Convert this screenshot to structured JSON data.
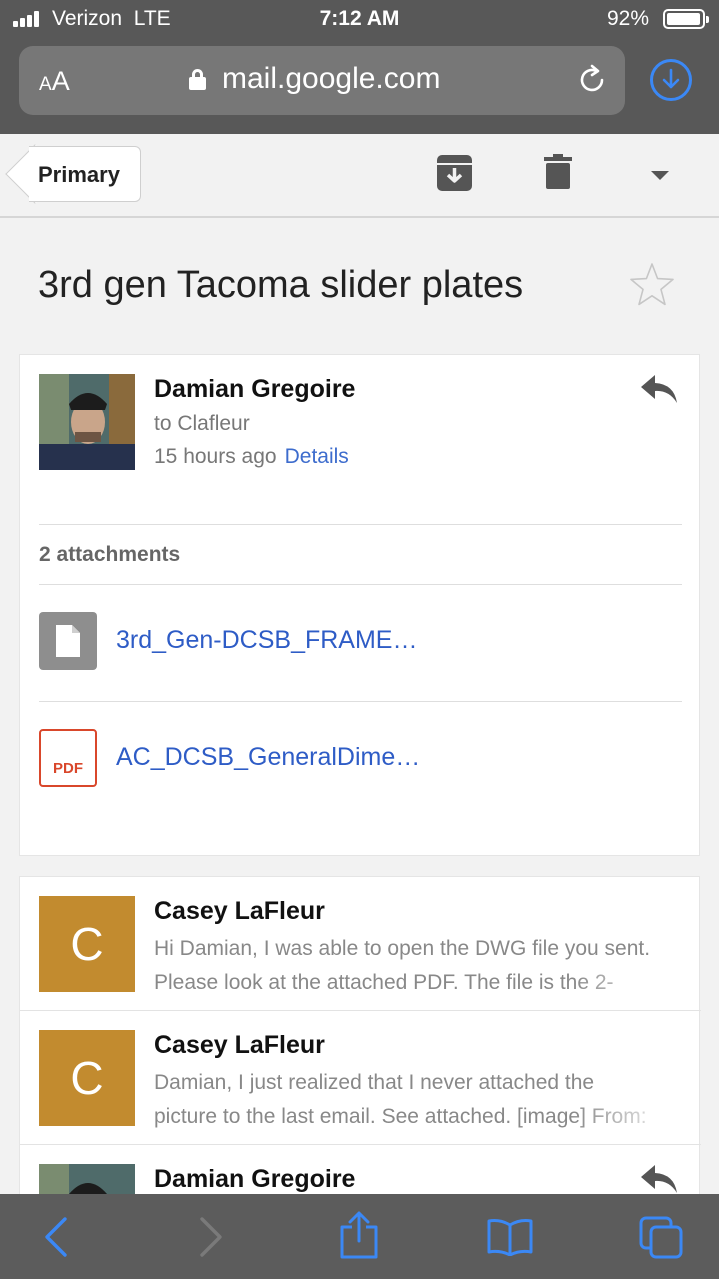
{
  "status": {
    "carrier": "Verizon",
    "network": "LTE",
    "time": "7:12 AM",
    "battery": "92%",
    "battery_level": 0.92
  },
  "browser": {
    "text_size_label_small": "A",
    "text_size_label_large": "A",
    "url": "mail.google.com",
    "icons": [
      "lock-icon",
      "reload-icon",
      "download-icon"
    ]
  },
  "toolbar": {
    "back_label": "Primary",
    "icons": [
      "archive-icon",
      "trash-icon",
      "more-dropdown-icon"
    ]
  },
  "email": {
    "subject": "3rd gen Tacoma slider plates",
    "starred": false,
    "sender": "Damian Gregoire",
    "recipient": "to Clafleur",
    "time": "15 hours ago",
    "details_label": "Details",
    "attachments_label": "2 attachments",
    "attachments": [
      {
        "name": "3rd_Gen-DCSB_FRAME…",
        "type": "file"
      },
      {
        "name": "AC_DCSB_GeneralDime…",
        "type": "pdf",
        "badge": "PDF"
      }
    ]
  },
  "thread": [
    {
      "avatar_letter": "C",
      "name": "Casey LaFleur",
      "line1": "Hi Damian, I was able to open the DWG file you sent.",
      "line2": "Please look at the attached PDF. The file is the 2-"
    },
    {
      "avatar_letter": "C",
      "name": "Casey LaFleur",
      "line1": "Damian, I just realized that I never attached the",
      "line2": "picture to the last email. See attached. [image] From:"
    },
    {
      "avatar_letter": "",
      "name": "Damian Gregoire",
      "line1": "",
      "line2": ""
    }
  ],
  "colors": {
    "avatar_letter_bg": "#c28b2f",
    "link": "#2e5cc6",
    "safari_bar": "#585858",
    "ios_blue": "#3b88f5",
    "pdf_red": "#d9472b"
  }
}
